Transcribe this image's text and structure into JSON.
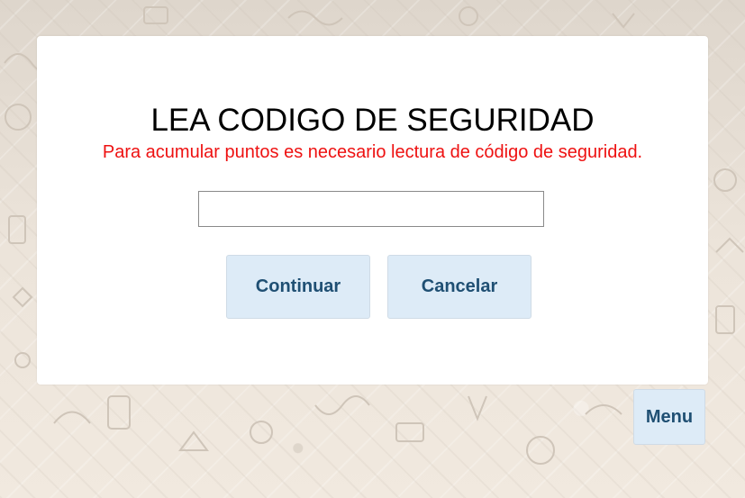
{
  "dialog": {
    "title": "LEA CODIGO DE SEGURIDAD",
    "message": "Para acumular puntos es necesario lectura de código de seguridad.",
    "code_input": {
      "value": "",
      "placeholder": ""
    },
    "continue_label": "Continuar",
    "cancel_label": "Cancelar"
  },
  "menu_label": "Menu",
  "colors": {
    "message_text": "#ee1111",
    "button_bg": "#ddebf7",
    "button_text": "#1f4f73",
    "panel_bg": "#ffffff"
  },
  "icons": {
    "background": "doodle-pattern"
  }
}
